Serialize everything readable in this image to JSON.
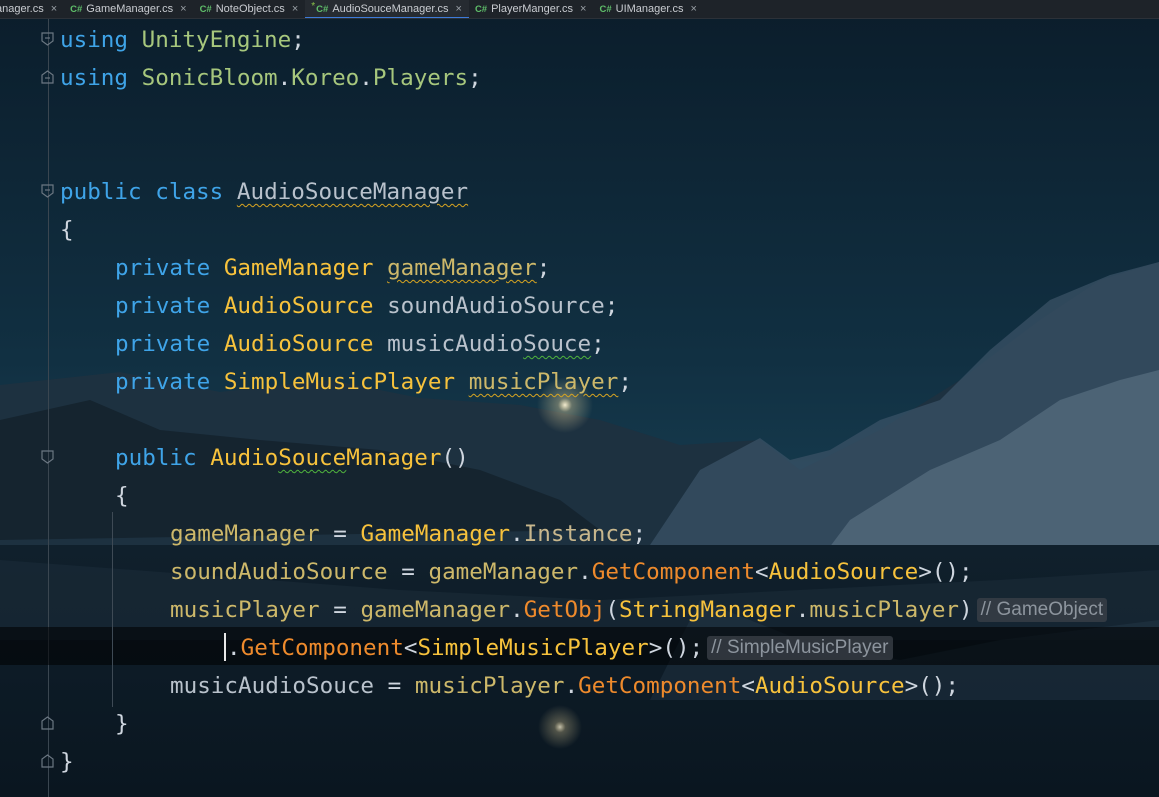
{
  "tabs": [
    {
      "lang": "",
      "name": "anager.cs",
      "active": false,
      "modified": false
    },
    {
      "lang": "C#",
      "name": "GameManager.cs",
      "active": false,
      "modified": false
    },
    {
      "lang": "C#",
      "name": "NoteObject.cs",
      "active": false,
      "modified": false
    },
    {
      "lang": "C#",
      "name": "AudioSouceManager.cs",
      "active": true,
      "modified": true
    },
    {
      "lang": "C#",
      "name": "PlayerManger.cs",
      "active": false,
      "modified": false
    },
    {
      "lang": "C#",
      "name": "UIManager.cs",
      "active": false,
      "modified": false
    }
  ],
  "tab_close_glyph": "×",
  "code": {
    "l1": {
      "kw": "using",
      "ns": "UnityEngine",
      "end": ";"
    },
    "l2": {
      "kw": "using",
      "ns1": "SonicBloom",
      "dot1": ".",
      "ns2": "Koreo",
      "dot2": ".",
      "ns3": "Players",
      "end": ";"
    },
    "l5": {
      "kw1": "public",
      "kw2": "class",
      "name": "AudioSouceManager"
    },
    "l6": {
      "brace": "{"
    },
    "l7": {
      "kw": "private",
      "type": "GameManager",
      "field": "gameManager",
      "end": ";"
    },
    "l8": {
      "kw": "private",
      "type": "AudioSource",
      "field": "soundAudioSource",
      "end": ";"
    },
    "l9": {
      "kw": "private",
      "type": "AudioSource",
      "field_a": "musicAudio",
      "field_b": "Souce",
      "end": ";"
    },
    "l10": {
      "kw": "private",
      "type": "SimpleMusicPlayer",
      "field": "musicPlayer",
      "end": ";"
    },
    "l12": {
      "kw": "public",
      "name_a": "Audio",
      "name_b": "Souce",
      "name_c": "Manager",
      "parens": "()"
    },
    "l13": {
      "brace": "{"
    },
    "l14": {
      "lhs": "gameManager",
      "op": " = ",
      "cls": "GameManager",
      "dot": ".",
      "prop": "Instance",
      "end": ";"
    },
    "l15": {
      "lhs": "soundAudioSource",
      "op": " = ",
      "obj": "gameManager",
      "dot": ".",
      "method": "GetComponent",
      "lt": "<",
      "type": "AudioSource",
      "gt": ">",
      "end": "();"
    },
    "l16": {
      "lhs": "musicPlayer",
      "op": " = ",
      "obj": "gameManager",
      "dot": ".",
      "method": "GetObj",
      "open": "(",
      "cls": "StringManager",
      "dot2": ".",
      "arg": "musicPlayer",
      "close": ")",
      "hint": "// GameObject"
    },
    "l17": {
      "dot": ".",
      "method": "GetComponent",
      "lt": "<",
      "type": "SimpleMusicPlayer",
      "gt": ">",
      "end": "();",
      "hint": "// SimpleMusicPlayer"
    },
    "l18": {
      "lhs": "musicAudioSouce",
      "op": " = ",
      "obj": "musicPlayer",
      "dot": ".",
      "method": "GetComponent",
      "lt": "<",
      "type": "AudioSource",
      "gt": ">",
      "end": "();"
    },
    "l19": {
      "brace": "}"
    },
    "l20": {
      "brace": "}"
    }
  },
  "colors": {
    "keyword": "#3fa4e8",
    "type": "#f7c23c",
    "method": "#ee8a2c",
    "namespace": "#a7c77d",
    "tab_active_underline": "#3d7bd9",
    "csharp_icon": "#5fbf6a"
  },
  "icons": {
    "fold": "fold-marker-icon"
  }
}
